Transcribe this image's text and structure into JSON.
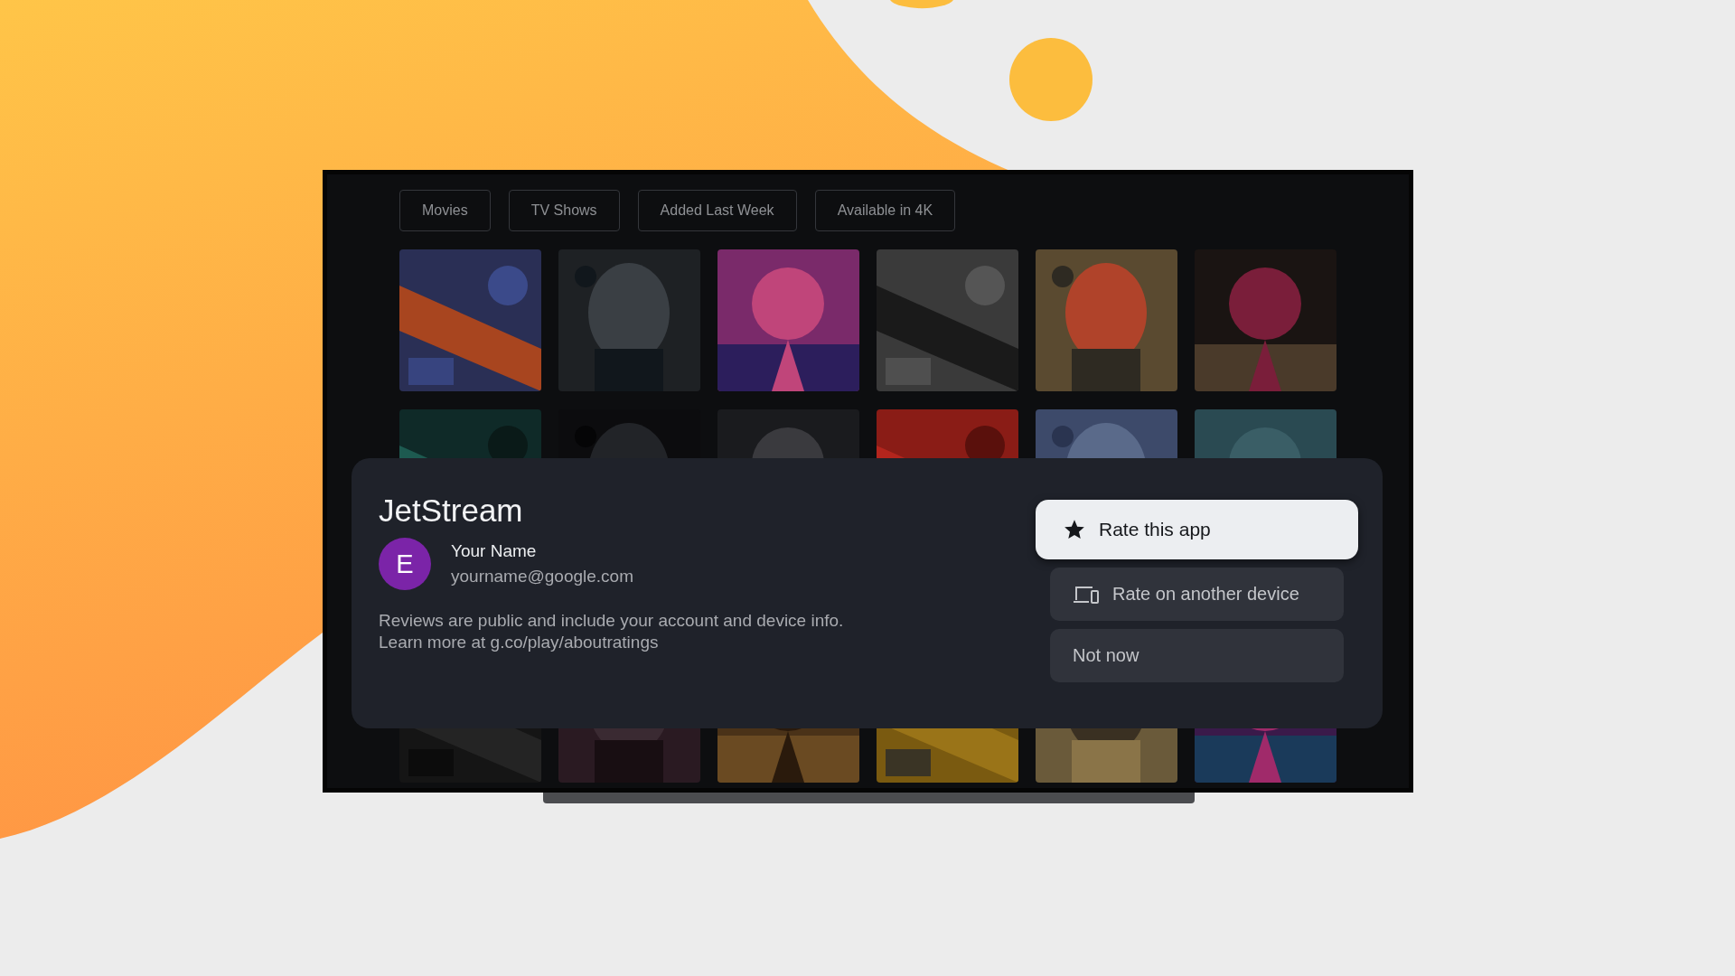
{
  "filters": [
    {
      "label": "Movies"
    },
    {
      "label": "TV Shows"
    },
    {
      "label": "Added Last Week"
    },
    {
      "label": "Available in 4K"
    }
  ],
  "dialog": {
    "title": "JetStream",
    "account": {
      "initial": "E",
      "name": "Your Name",
      "email": "yourname@google.com"
    },
    "notice": "Reviews are public and include your account and device info. Learn more at g.co/play/aboutratings",
    "actions": [
      {
        "label": "Rate this app",
        "kind": "star",
        "selected": true
      },
      {
        "label": "Rate on another device",
        "kind": "devices",
        "selected": false
      },
      {
        "label": "Not now",
        "kind": "plain",
        "selected": false
      }
    ]
  }
}
